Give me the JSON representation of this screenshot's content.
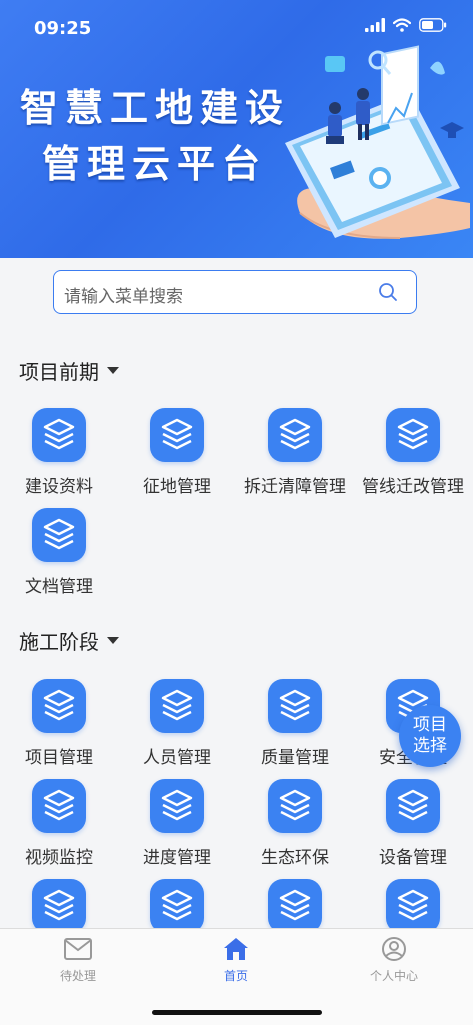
{
  "status_bar": {
    "time": "09:25"
  },
  "banner": {
    "title_line1": "智慧工地建设",
    "title_line2": "管理云平台"
  },
  "search": {
    "placeholder": "请输入菜单搜索"
  },
  "sections": [
    {
      "title": "项目前期",
      "items": [
        "建设资料",
        "征地管理",
        "拆迁清障管理",
        "管线迁改管理",
        "文档管理"
      ]
    },
    {
      "title": "施工阶段",
      "items": [
        "项目管理",
        "人员管理",
        "质量管理",
        "安全管理",
        "视频监控",
        "进度管理",
        "生态环保",
        "设备管理"
      ]
    }
  ],
  "float_button": {
    "line1": "项目",
    "line2": "选择"
  },
  "tabbar": {
    "items": [
      {
        "label": "待处理",
        "icon": "mail-icon"
      },
      {
        "label": "首页",
        "icon": "home-icon",
        "active": true
      },
      {
        "label": "个人中心",
        "icon": "user-icon"
      }
    ]
  },
  "colors": {
    "accent": "#3b82f2",
    "banner": "#3a78f0",
    "tab_active": "#3b6ee8",
    "tab_inactive": "#999999"
  }
}
